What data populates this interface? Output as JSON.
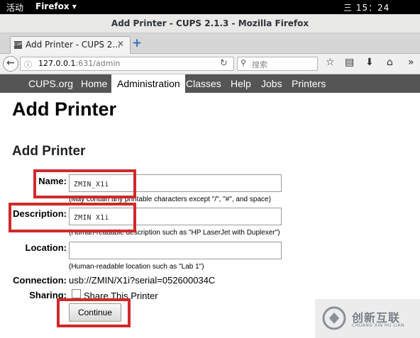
{
  "topbar": {
    "activities": "活动",
    "app": "Firefox ▾",
    "clock": "三 15：24"
  },
  "window": {
    "title": "Add Printer - CUPS 2.1.3 - Mozilla Firefox"
  },
  "tab": {
    "favicon": "CUPS",
    "title": "Add Printer - CUPS 2...",
    "close": "✕",
    "new": "+"
  },
  "navbar": {
    "url_host": "127.0.0.1",
    "url_path": ":631/admin",
    "search_placeholder": "搜索"
  },
  "cups_nav": {
    "items": [
      "CUPS.org",
      "Home",
      "Administration",
      "Classes",
      "Help",
      "Jobs",
      "Printers"
    ],
    "active": "Administration"
  },
  "page": {
    "title": "Add Printer",
    "section_title": "Add Printer",
    "name_label": "Name:",
    "name_value": "ZMIN_X1i",
    "name_hint": "(May contain any printable characters except \"/\", \"#\", and space)",
    "description_label": "Description:",
    "description_value": "ZMIN X1i",
    "description_hint": "(Human-readable description such as \"HP LaserJet with Duplexer\")",
    "location_label": "Location:",
    "location_value": "",
    "location_hint": "(Human-readable location such as \"Lab 1\")",
    "connection_label": "Connection:",
    "connection_value": "usb://ZMIN/X1i?serial=052600034C",
    "sharing_label": "Sharing:",
    "share_checkbox_label": "Share This Printer",
    "share_checked": false,
    "continue_label": "Continue"
  },
  "watermark": {
    "brand_cn": "创新互联",
    "brand_en": "CHUANG XIN HU LIAN"
  },
  "colors": {
    "cups_nav_bg": "#555555",
    "highlight_box": "#d02a2a",
    "topbar_bg": "#000000"
  }
}
